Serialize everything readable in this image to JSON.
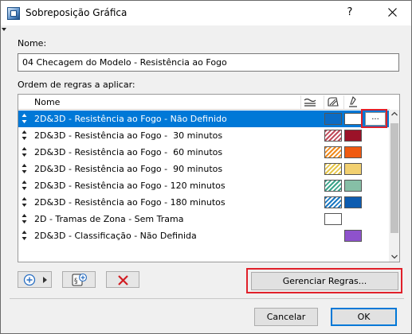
{
  "window": {
    "title": "Sobreposição Gráfica",
    "help_label": "?"
  },
  "form": {
    "name_label": "Nome:",
    "name_value": "04 Checagem do Modelo - Resistência ao Fogo",
    "rules_label": "Ordem de regras a aplicar:"
  },
  "list": {
    "header_name": "Nome",
    "header_icons": [
      "surface-icon",
      "fill-icon",
      "pen-icon"
    ],
    "rows": [
      {
        "label": "2D&3D - Resistência ao Fogo - Não Definido",
        "selected": true,
        "fill_color": "#0b6bc4",
        "fill_pattern": "solid",
        "surface_color": "#ffffff"
      },
      {
        "label": "2D&3D - Resistência ao Fogo -  30 minutos",
        "selected": false,
        "fill_color": "#c04a5a",
        "fill_pattern": "hatch",
        "surface_color": "#9b1228"
      },
      {
        "label": "2D&3D - Resistência ao Fogo -  60 minutos",
        "selected": false,
        "fill_color": "#f08a1c",
        "fill_pattern": "hatch",
        "surface_color": "#f05a10"
      },
      {
        "label": "2D&3D - Resistência ao Fogo -  90 minutos",
        "selected": false,
        "fill_color": "#e6c64a",
        "fill_pattern": "hatch",
        "surface_color": "#f2d070"
      },
      {
        "label": "2D&3D - Resistência ao Fogo - 120 minutos",
        "selected": false,
        "fill_color": "#3aa48a",
        "fill_pattern": "hatch",
        "surface_color": "#86bfa6"
      },
      {
        "label": "2D&3D - Resistência ao Fogo - 180 minutos",
        "selected": false,
        "fill_color": "#1a78c2",
        "fill_pattern": "hatch",
        "surface_color": "#0d5cb0"
      },
      {
        "label": "2D - Tramas de Zona - Sem Trama",
        "selected": false,
        "fill_color": "#ffffff",
        "fill_pattern": "solid",
        "surface_color": ""
      },
      {
        "label": "2D&3D - Classificação - Não Definida",
        "selected": false,
        "fill_color": "",
        "fill_pattern": "",
        "surface_color": "#8e52cc"
      }
    ],
    "ellipsis_label": "..."
  },
  "toolbar": {
    "add_icon": "plus-circle-icon",
    "import_icon": "rule-import-icon",
    "delete_icon": "red-x-icon"
  },
  "buttons": {
    "manage_rules": "Gerenciar Regras...",
    "cancel": "Cancelar",
    "ok": "OK"
  },
  "colors": {
    "selection": "#0078d7",
    "highlight": "#e0202a"
  }
}
